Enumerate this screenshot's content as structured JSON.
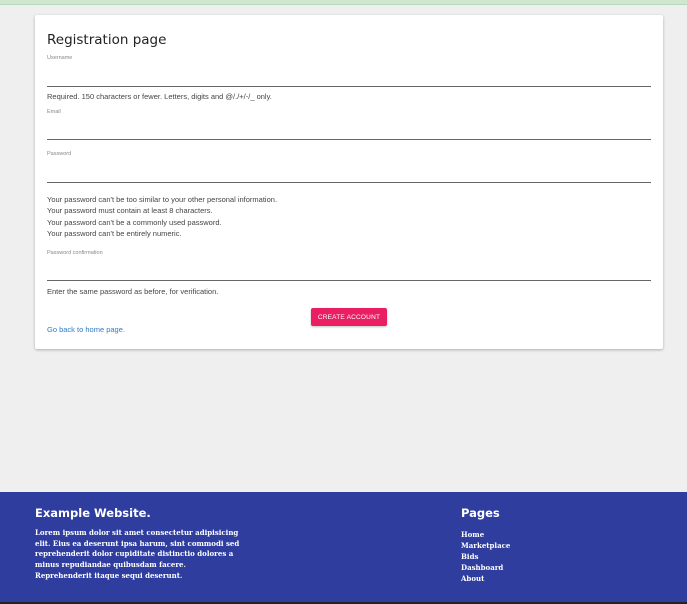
{
  "form": {
    "title": "Registration page",
    "username_label": "Username",
    "username_help": "Required. 150 characters or fewer. Letters, digits and @/./+/-/_ only.",
    "email_label": "Email",
    "password_label": "Password",
    "password_help": [
      "Your password can't be too similar to your other personal information.",
      "Your password must contain at least 8 characters.",
      "Your password can't be a commonly used password.",
      "Your password can't be entirely numeric."
    ],
    "password_confirm_label": "Password confirmation",
    "password_confirm_help": "Enter the same password as before, for verification.",
    "submit_label": "CREATE ACCOUNT",
    "home_link": "Go back to home page."
  },
  "footer": {
    "brand": "Example Website.",
    "lorem": "Lorem ipsum dolor sit amet consectetur adipisicing elit. Eius ea deserunt ipsa harum, sint commodi sed reprehenderit dolor cupiditate distinctio dolores a minus repudiandae quibusdam facere. Reprehenderit itaque sequi deserunt.",
    "pages_title": "Pages",
    "links": [
      "Home",
      "Marketplace",
      "Bids",
      "Dashboard",
      "About"
    ]
  },
  "colors": {
    "accent": "#e91e63",
    "footer_bg": "#2f3d9e",
    "link": "#2f7bc9",
    "page_bg": "#efefef"
  }
}
